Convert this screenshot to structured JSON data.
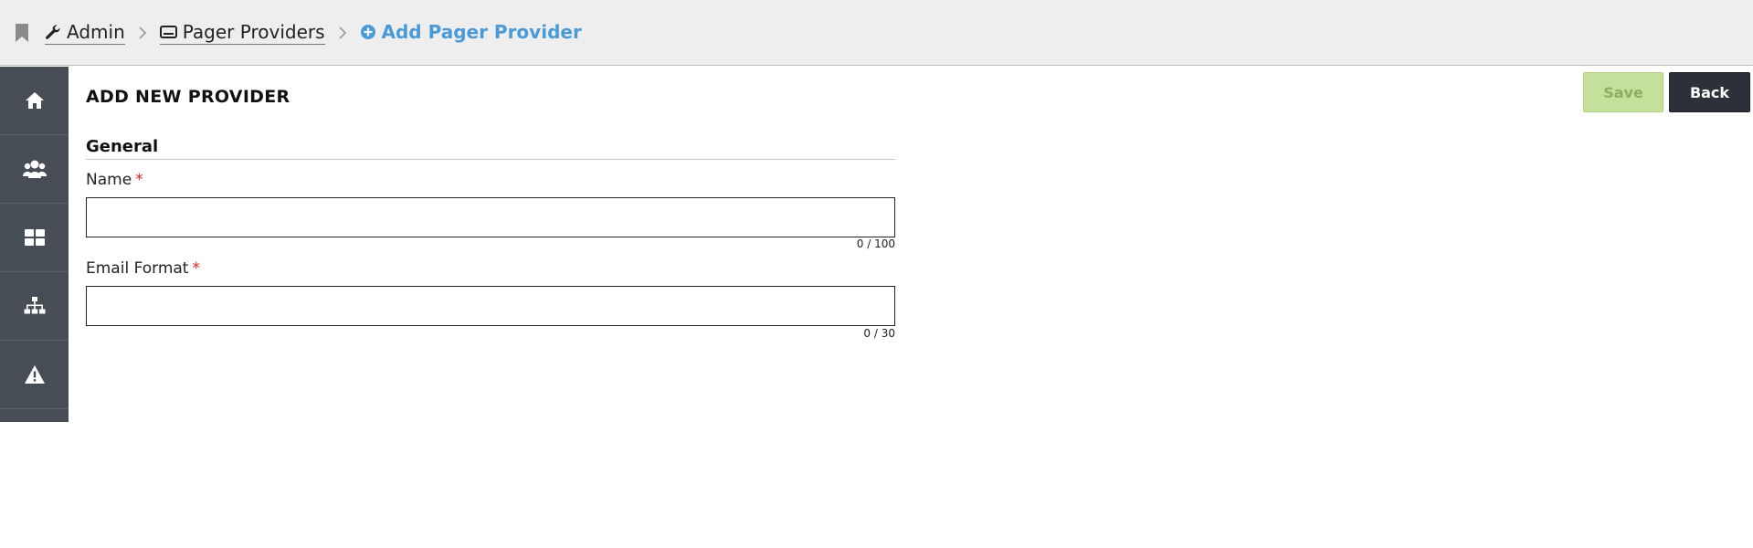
{
  "breadcrumb": {
    "items": [
      {
        "label": "Admin",
        "icon": "wrench-icon"
      },
      {
        "label": "Pager Providers",
        "icon": "pager-icon"
      },
      {
        "label": "Add Pager Provider",
        "icon": "plus-circle-icon"
      }
    ],
    "accent_color": "#4a9ad8"
  },
  "sidebar": {
    "items": [
      {
        "icon": "home-icon"
      },
      {
        "icon": "users-icon"
      },
      {
        "icon": "dashboard-grid-icon"
      },
      {
        "icon": "sitemap-icon"
      },
      {
        "icon": "warning-icon"
      }
    ]
  },
  "page": {
    "title": "ADD NEW PROVIDER",
    "save_label": "Save",
    "back_label": "Back"
  },
  "form": {
    "section_title": "General",
    "fields": [
      {
        "label": "Name",
        "required_mark": "*",
        "value": "",
        "counter": "0 / 100"
      },
      {
        "label": "Email Format",
        "required_mark": "*",
        "value": "",
        "counter": "0 / 30"
      }
    ]
  }
}
